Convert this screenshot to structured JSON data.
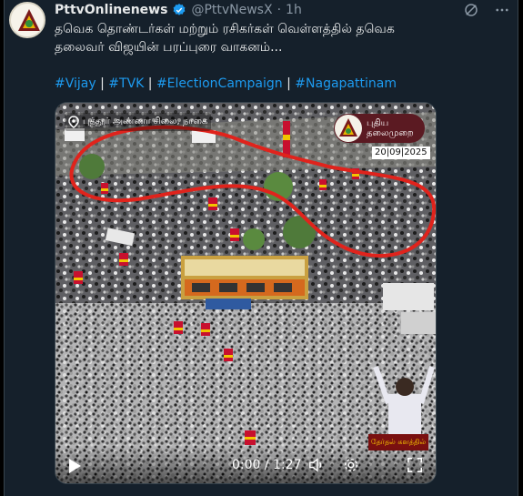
{
  "tweet": {
    "display_name": "PttvOnlinenews",
    "handle": "@PttvNewsX",
    "separator": "·",
    "time": "1h",
    "text_line1": "தவெக தொண்டர்கள் மற்றும் ரசிகர்கள் வெள்ளத்தில் தவெக",
    "text_line2": "தலைவர் விஜயின் பரப்புரை வாகனம்...",
    "hashtags": [
      "#Vijay",
      "#TVK",
      "#ElectionCampaign",
      "#Nagapattinam"
    ],
    "hashtag_separator": " | "
  },
  "video": {
    "location_label": "புத்தூர் அண்ணா சிலை, நாகை",
    "channel_name_line1": "புதிய",
    "channel_name_line2": "தலைமுறை",
    "date": "20|09|2025",
    "corner_label": "தேர்தல் களத்தில்",
    "timecode": "0:00 / 1:27"
  },
  "colors": {
    "background": "#15202b",
    "link": "#1d9bf0",
    "verified": "#1d9bf0",
    "annotation": "#e0231c"
  },
  "icons": {
    "verified": "verified-badge-icon",
    "grok": "grok-icon",
    "more": "more-icon",
    "location": "location-pin-icon",
    "play": "play-icon",
    "volume": "volume-icon",
    "settings": "settings-icon",
    "fullscreen": "fullscreen-icon"
  }
}
